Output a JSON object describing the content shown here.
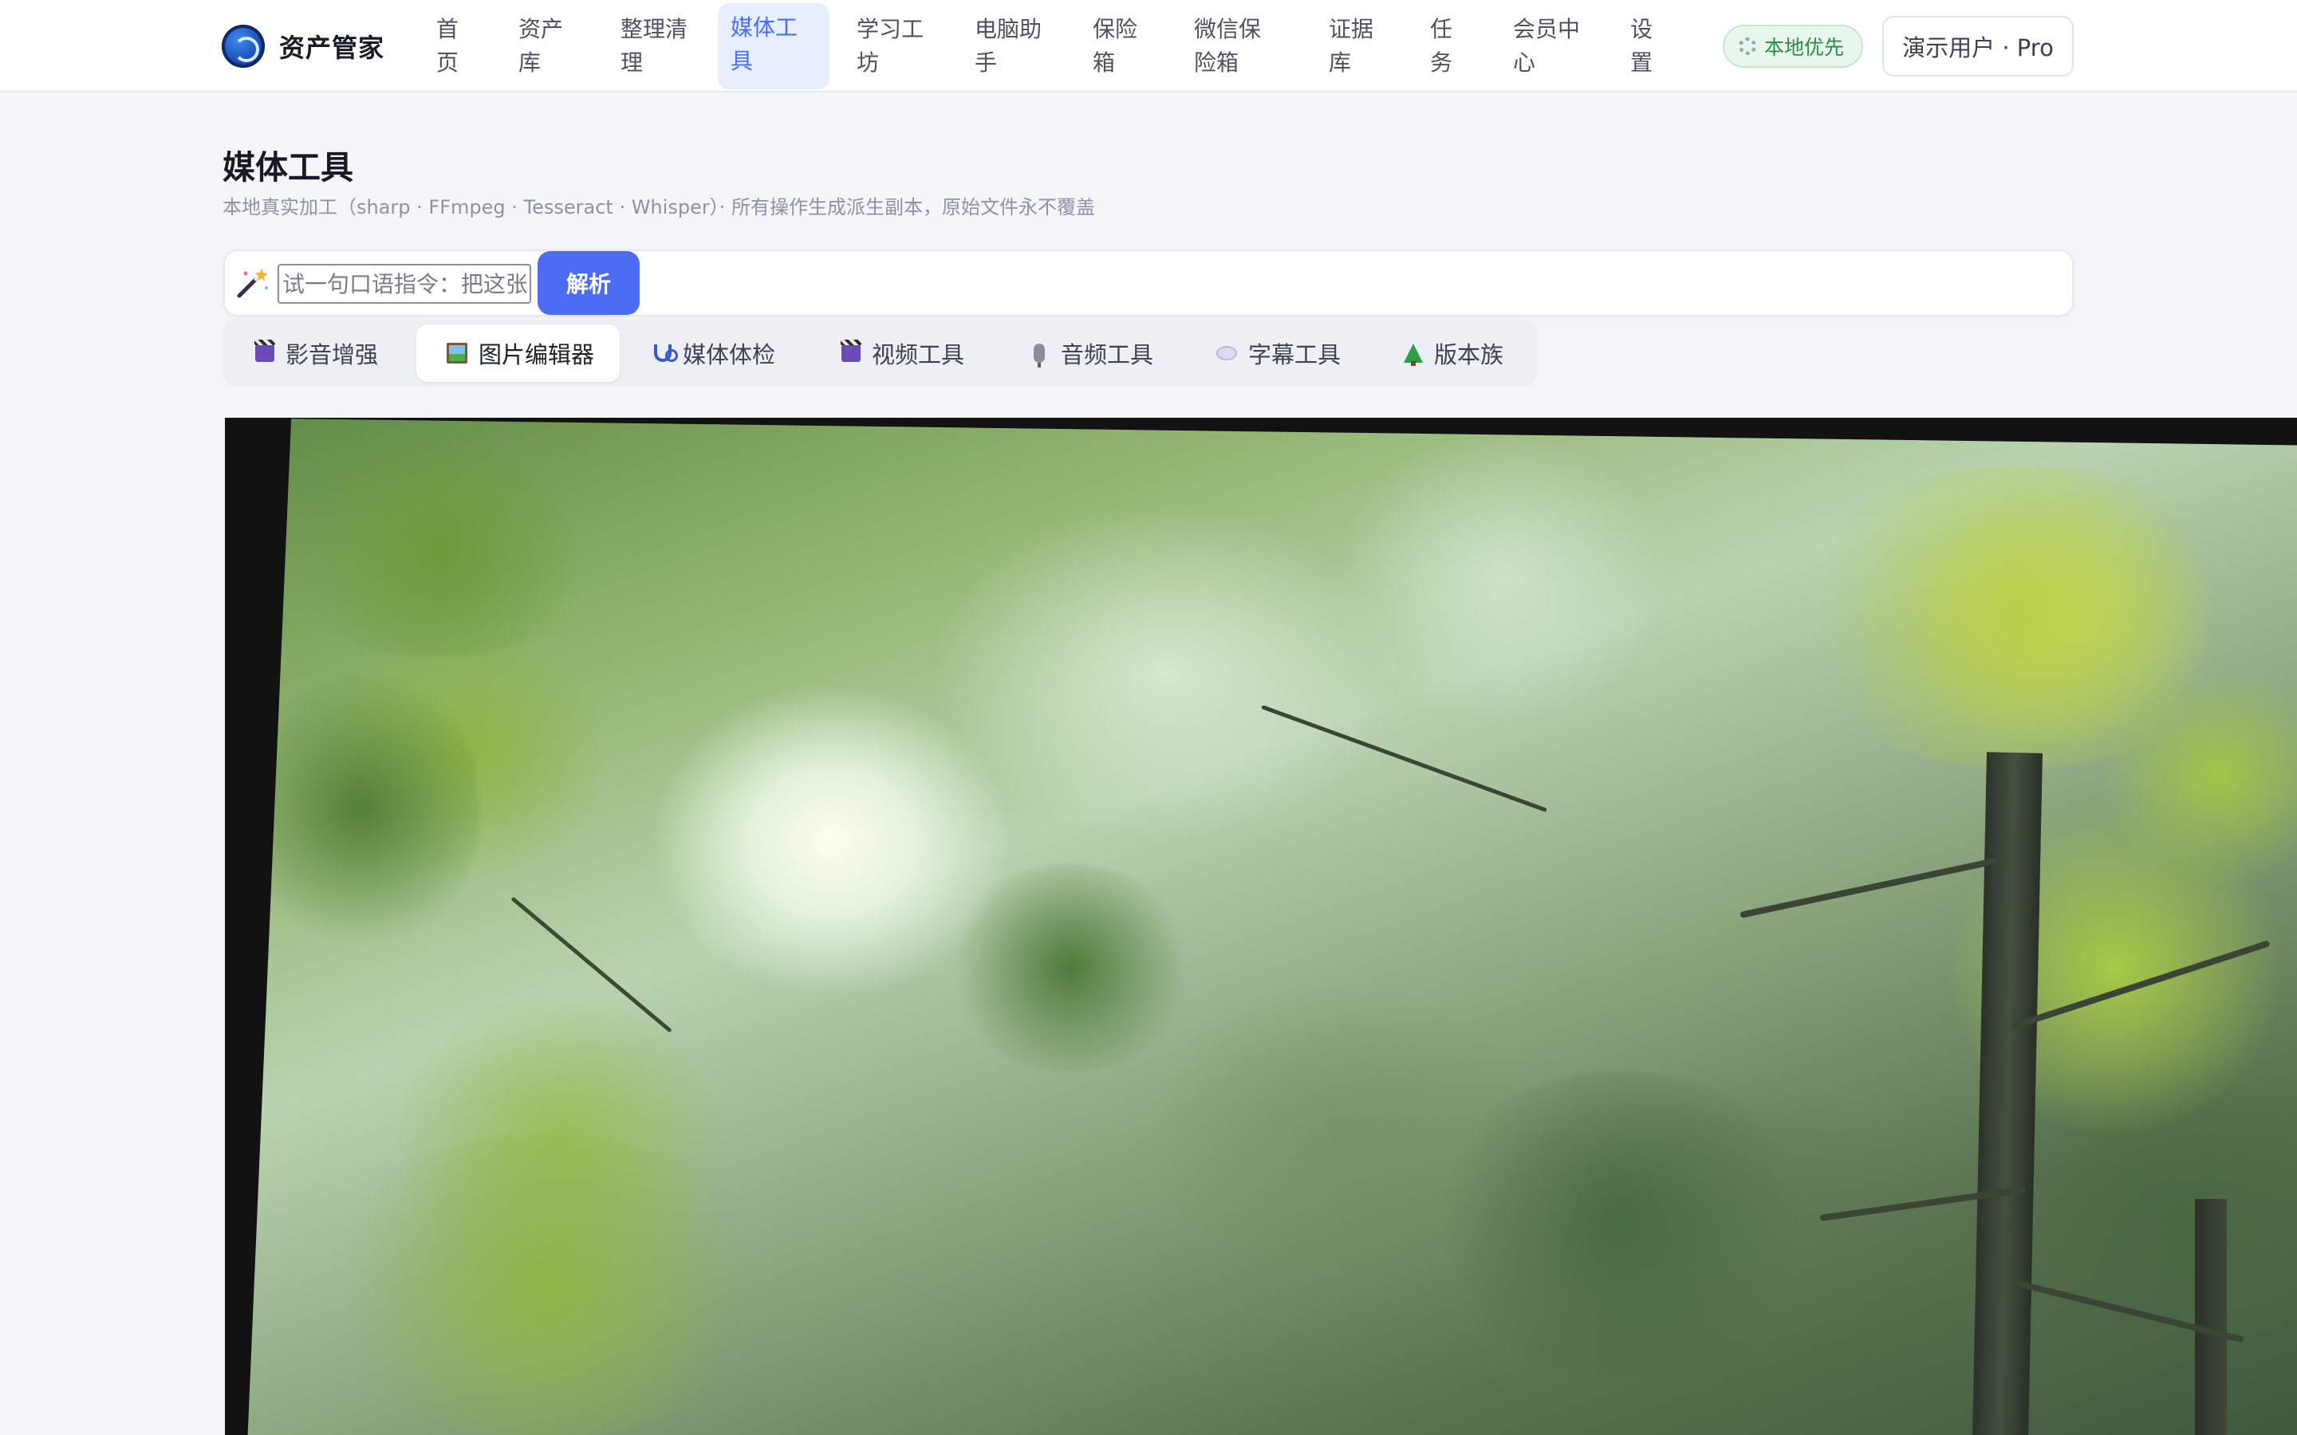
{
  "app": {
    "name": "资产管家"
  },
  "nav": {
    "items": [
      {
        "line1": "首",
        "line2": "页"
      },
      {
        "line1": "资产",
        "line2": "库"
      },
      {
        "line1": "整理清",
        "line2": "理"
      },
      {
        "line1": "媒体工",
        "line2": "具"
      },
      {
        "line1": "学习工",
        "line2": "坊"
      },
      {
        "line1": "电脑助",
        "line2": "手"
      },
      {
        "line1": "保险",
        "line2": "箱"
      },
      {
        "line1": "微信保",
        "line2": "险箱"
      },
      {
        "line1": "证据",
        "line2": "库"
      },
      {
        "line1": "任",
        "line2": "务"
      },
      {
        "line1": "会员中",
        "line2": "心"
      },
      {
        "line1": "设",
        "line2": "置"
      }
    ],
    "active_index": 3
  },
  "status": {
    "local_badge": "本地优先",
    "user_label": "演示用户 · Pro"
  },
  "page": {
    "title": "媒体工具",
    "subtitle": "本地真实加工（sharp · FFmpeg · Tesseract · Whisper）· 所有操作生成派生副本，原始文件永不覆盖"
  },
  "command": {
    "placeholder": "试一句口语指令：把这张",
    "parse_label": "解析"
  },
  "tool_tabs": {
    "items": [
      {
        "label": "影音增强",
        "icon": "clapper-board-icon"
      },
      {
        "label": "图片编辑器",
        "icon": "framed-picture-icon"
      },
      {
        "label": "媒体体检",
        "icon": "stethoscope-icon"
      },
      {
        "label": "视频工具",
        "icon": "clapper-board-icon"
      },
      {
        "label": "音频工具",
        "icon": "microphone-icon"
      },
      {
        "label": "字幕工具",
        "icon": "speech-bubble-icon"
      },
      {
        "label": "版本族",
        "icon": "tree-icon"
      }
    ],
    "active_index": 1
  },
  "colors": {
    "accent": "#4d6cf5",
    "nav_active_bg": "#e7eeff",
    "badge_green": "#2c8a4a",
    "canvas_bg": "#121212"
  }
}
